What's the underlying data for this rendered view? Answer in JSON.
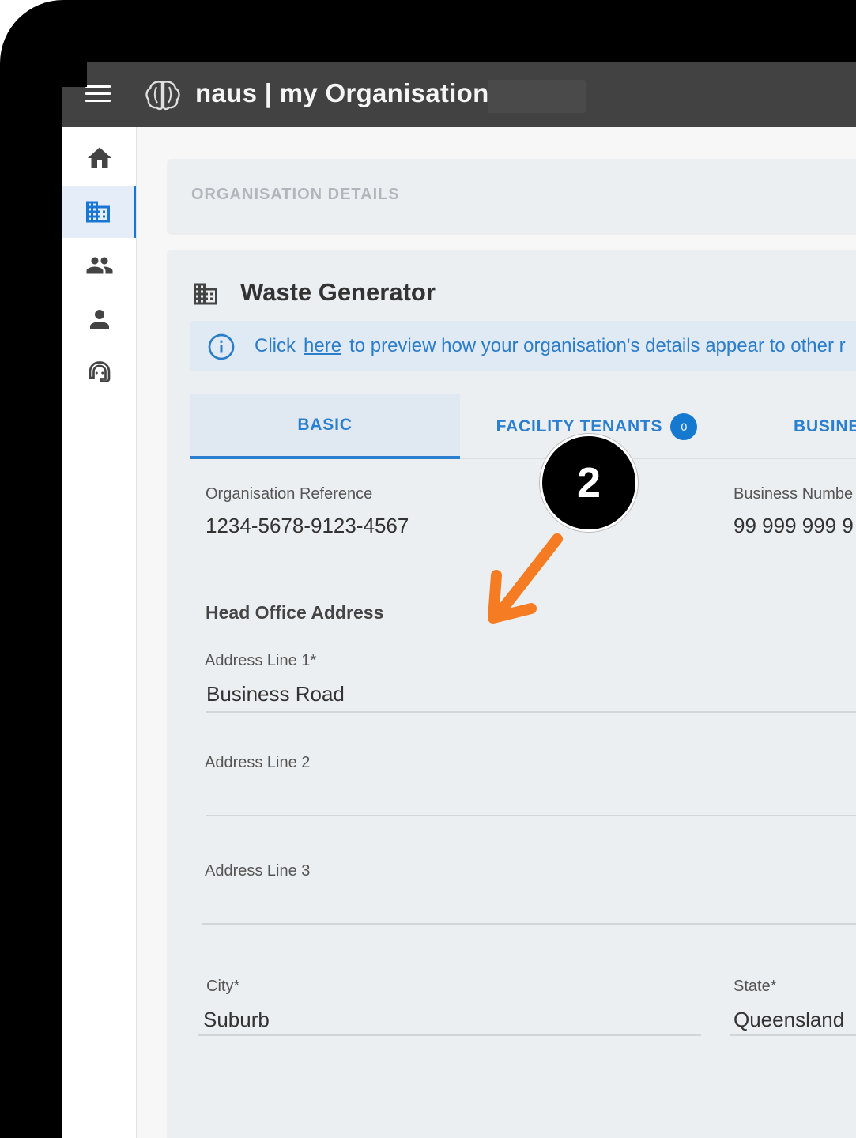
{
  "app": {
    "title": "naus | my Organisation"
  },
  "nav": {
    "items": [
      {
        "icon": "home-icon"
      },
      {
        "icon": "organisation-icon",
        "active": true
      },
      {
        "icon": "people-icon"
      },
      {
        "icon": "person-icon"
      },
      {
        "icon": "support-agent-icon"
      }
    ]
  },
  "page": {
    "section_header": "ORGANISATION DETAILS",
    "card_title": "Waste Generator",
    "info": {
      "prefix": "Click",
      "link": "here",
      "suffix": "to preview how your organisation's details appear to other r"
    },
    "tabs": {
      "basic": "BASIC",
      "tenants": "FACILITY TENANTS",
      "tenants_count": "0",
      "business": "BUSINE"
    }
  },
  "form": {
    "org_reference": {
      "label": "Organisation Reference",
      "value": "1234-5678-9123-4567"
    },
    "business_number": {
      "label": "Business Numbe",
      "value": "99 999 999 9"
    },
    "head_office_heading": "Head Office Address",
    "address_line1": {
      "label": "Address Line 1*",
      "value": "Business Road"
    },
    "address_line2": {
      "label": "Address Line 2",
      "value": ""
    },
    "address_line3": {
      "label": "Address Line 3",
      "value": ""
    },
    "city": {
      "label": "City*",
      "value": "Suburb"
    },
    "state": {
      "label": "State*",
      "value": "Queensland"
    }
  },
  "annotation": {
    "step_number": "2",
    "arrow_color": "#f57c22"
  },
  "colors": {
    "app_bar": "#424242",
    "accent": "#2a7fd0",
    "card_bg": "#eceff1"
  }
}
